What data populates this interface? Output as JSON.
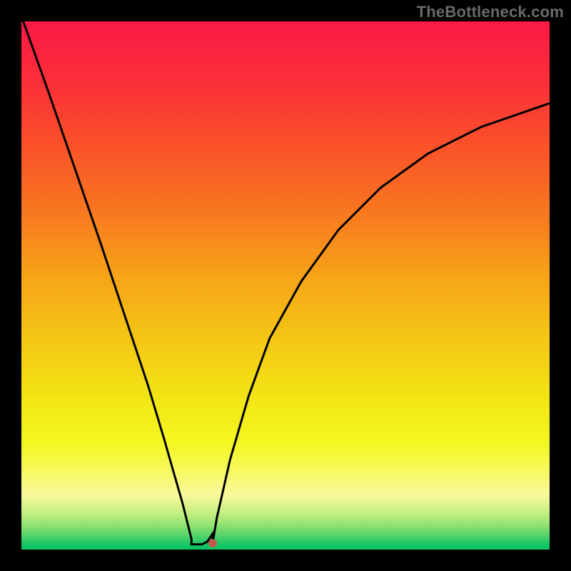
{
  "watermark": {
    "text": "TheBottleneck.com"
  },
  "colors": {
    "background": "#000000",
    "curve_stroke": "#000000",
    "marker_fill": "#c05a4d"
  },
  "chart_data": {
    "type": "line",
    "title": "",
    "xlabel": "",
    "ylabel": "",
    "xlim": [
      0,
      1
    ],
    "ylim": [
      0,
      1
    ],
    "gradient_stops": [
      {
        "offset": 0.0,
        "color": "#fa1946"
      },
      {
        "offset": 0.12,
        "color": "#fb3038"
      },
      {
        "offset": 0.22,
        "color": "#fa4d2b"
      },
      {
        "offset": 0.35,
        "color": "#f87420"
      },
      {
        "offset": 0.48,
        "color": "#f6a318"
      },
      {
        "offset": 0.6,
        "color": "#f4c615"
      },
      {
        "offset": 0.72,
        "color": "#f2e714"
      },
      {
        "offset": 0.8,
        "color": "#f4f721"
      },
      {
        "offset": 0.85,
        "color": "#f7f95d"
      },
      {
        "offset": 0.895,
        "color": "#faf99b"
      },
      {
        "offset": 0.93,
        "color": "#c7f081"
      },
      {
        "offset": 0.955,
        "color": "#8ee170"
      },
      {
        "offset": 0.975,
        "color": "#50d268"
      },
      {
        "offset": 0.99,
        "color": "#17c666"
      },
      {
        "offset": 1.0,
        "color": "#0cc264"
      }
    ],
    "series": [
      {
        "name": "bottleneck-curve",
        "x": [
          0.0,
          0.05,
          0.1,
          0.15,
          0.2,
          0.24,
          0.27,
          0.29,
          0.305,
          0.315,
          0.322,
          0.322,
          0.342,
          0.352,
          0.362,
          0.362,
          0.37,
          0.395,
          0.43,
          0.47,
          0.53,
          0.6,
          0.68,
          0.77,
          0.87,
          1.0
        ],
        "y": [
          1.01,
          0.87,
          0.725,
          0.58,
          0.43,
          0.31,
          0.21,
          0.14,
          0.088,
          0.048,
          0.02,
          0.01,
          0.01,
          0.015,
          0.03,
          0.012,
          0.06,
          0.17,
          0.29,
          0.4,
          0.508,
          0.605,
          0.685,
          0.75,
          0.8,
          0.845
        ]
      }
    ],
    "marker": {
      "x": 0.362,
      "y": 0.012,
      "r": 0.008
    }
  }
}
